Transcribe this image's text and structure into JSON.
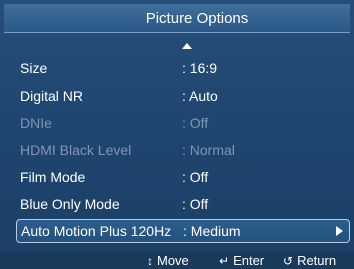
{
  "menu": {
    "title": "Picture Options",
    "items": [
      {
        "label": "Size",
        "value": ": 16:9"
      },
      {
        "label": "Digital NR",
        "value": ": Auto"
      },
      {
        "label": "DNIe",
        "value": ": Off"
      },
      {
        "label": "HDMI Black Level",
        "value": ": Normal"
      },
      {
        "label": "Film Mode",
        "value": ": Off"
      },
      {
        "label": "Blue Only Mode",
        "value": ": Off"
      },
      {
        "label": "Auto Motion Plus 120Hz",
        "value": ": Medium"
      }
    ]
  },
  "footer": {
    "move_label": "Move",
    "enter_label": "Enter",
    "return_label": "Return"
  },
  "colors": {
    "panel": "#1f4670",
    "title_bar": "#2b5886",
    "disabled_text": "#7e97b0",
    "footer": "#1a3a5c"
  }
}
